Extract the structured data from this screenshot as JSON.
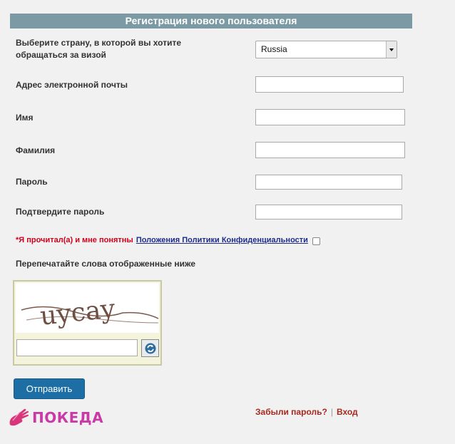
{
  "header": {
    "title": "Регистрация нового пользователя"
  },
  "form": {
    "country_label": "Выберите страну, в которой вы хотите обращаться за визой",
    "country_value": "Russia",
    "email_label": "Адрес электронной почты",
    "firstname_label": "Имя",
    "lastname_label": "Фамилия",
    "password_label": "Пароль",
    "confirm_label": "Подтвердите пароль"
  },
  "agreement": {
    "required_text": "*Я прочитал(а) и мне понятны",
    "link_text": "Положения Политики Конфиденциальности"
  },
  "captcha": {
    "label": "Перепечатайте слова отображенные ниже",
    "word": "uycay"
  },
  "submit": {
    "label": "Отправить"
  },
  "logo": {
    "text": "ПОКЕДА"
  },
  "footer": {
    "forgot": "Забыли пароль?",
    "separator": "|",
    "login": "Вход"
  },
  "colors": {
    "header_bg": "#7b9aa3",
    "submit_bg": "#1c6ea4",
    "link_red": "#a8281f",
    "logo_pink": "#c93aa6"
  }
}
